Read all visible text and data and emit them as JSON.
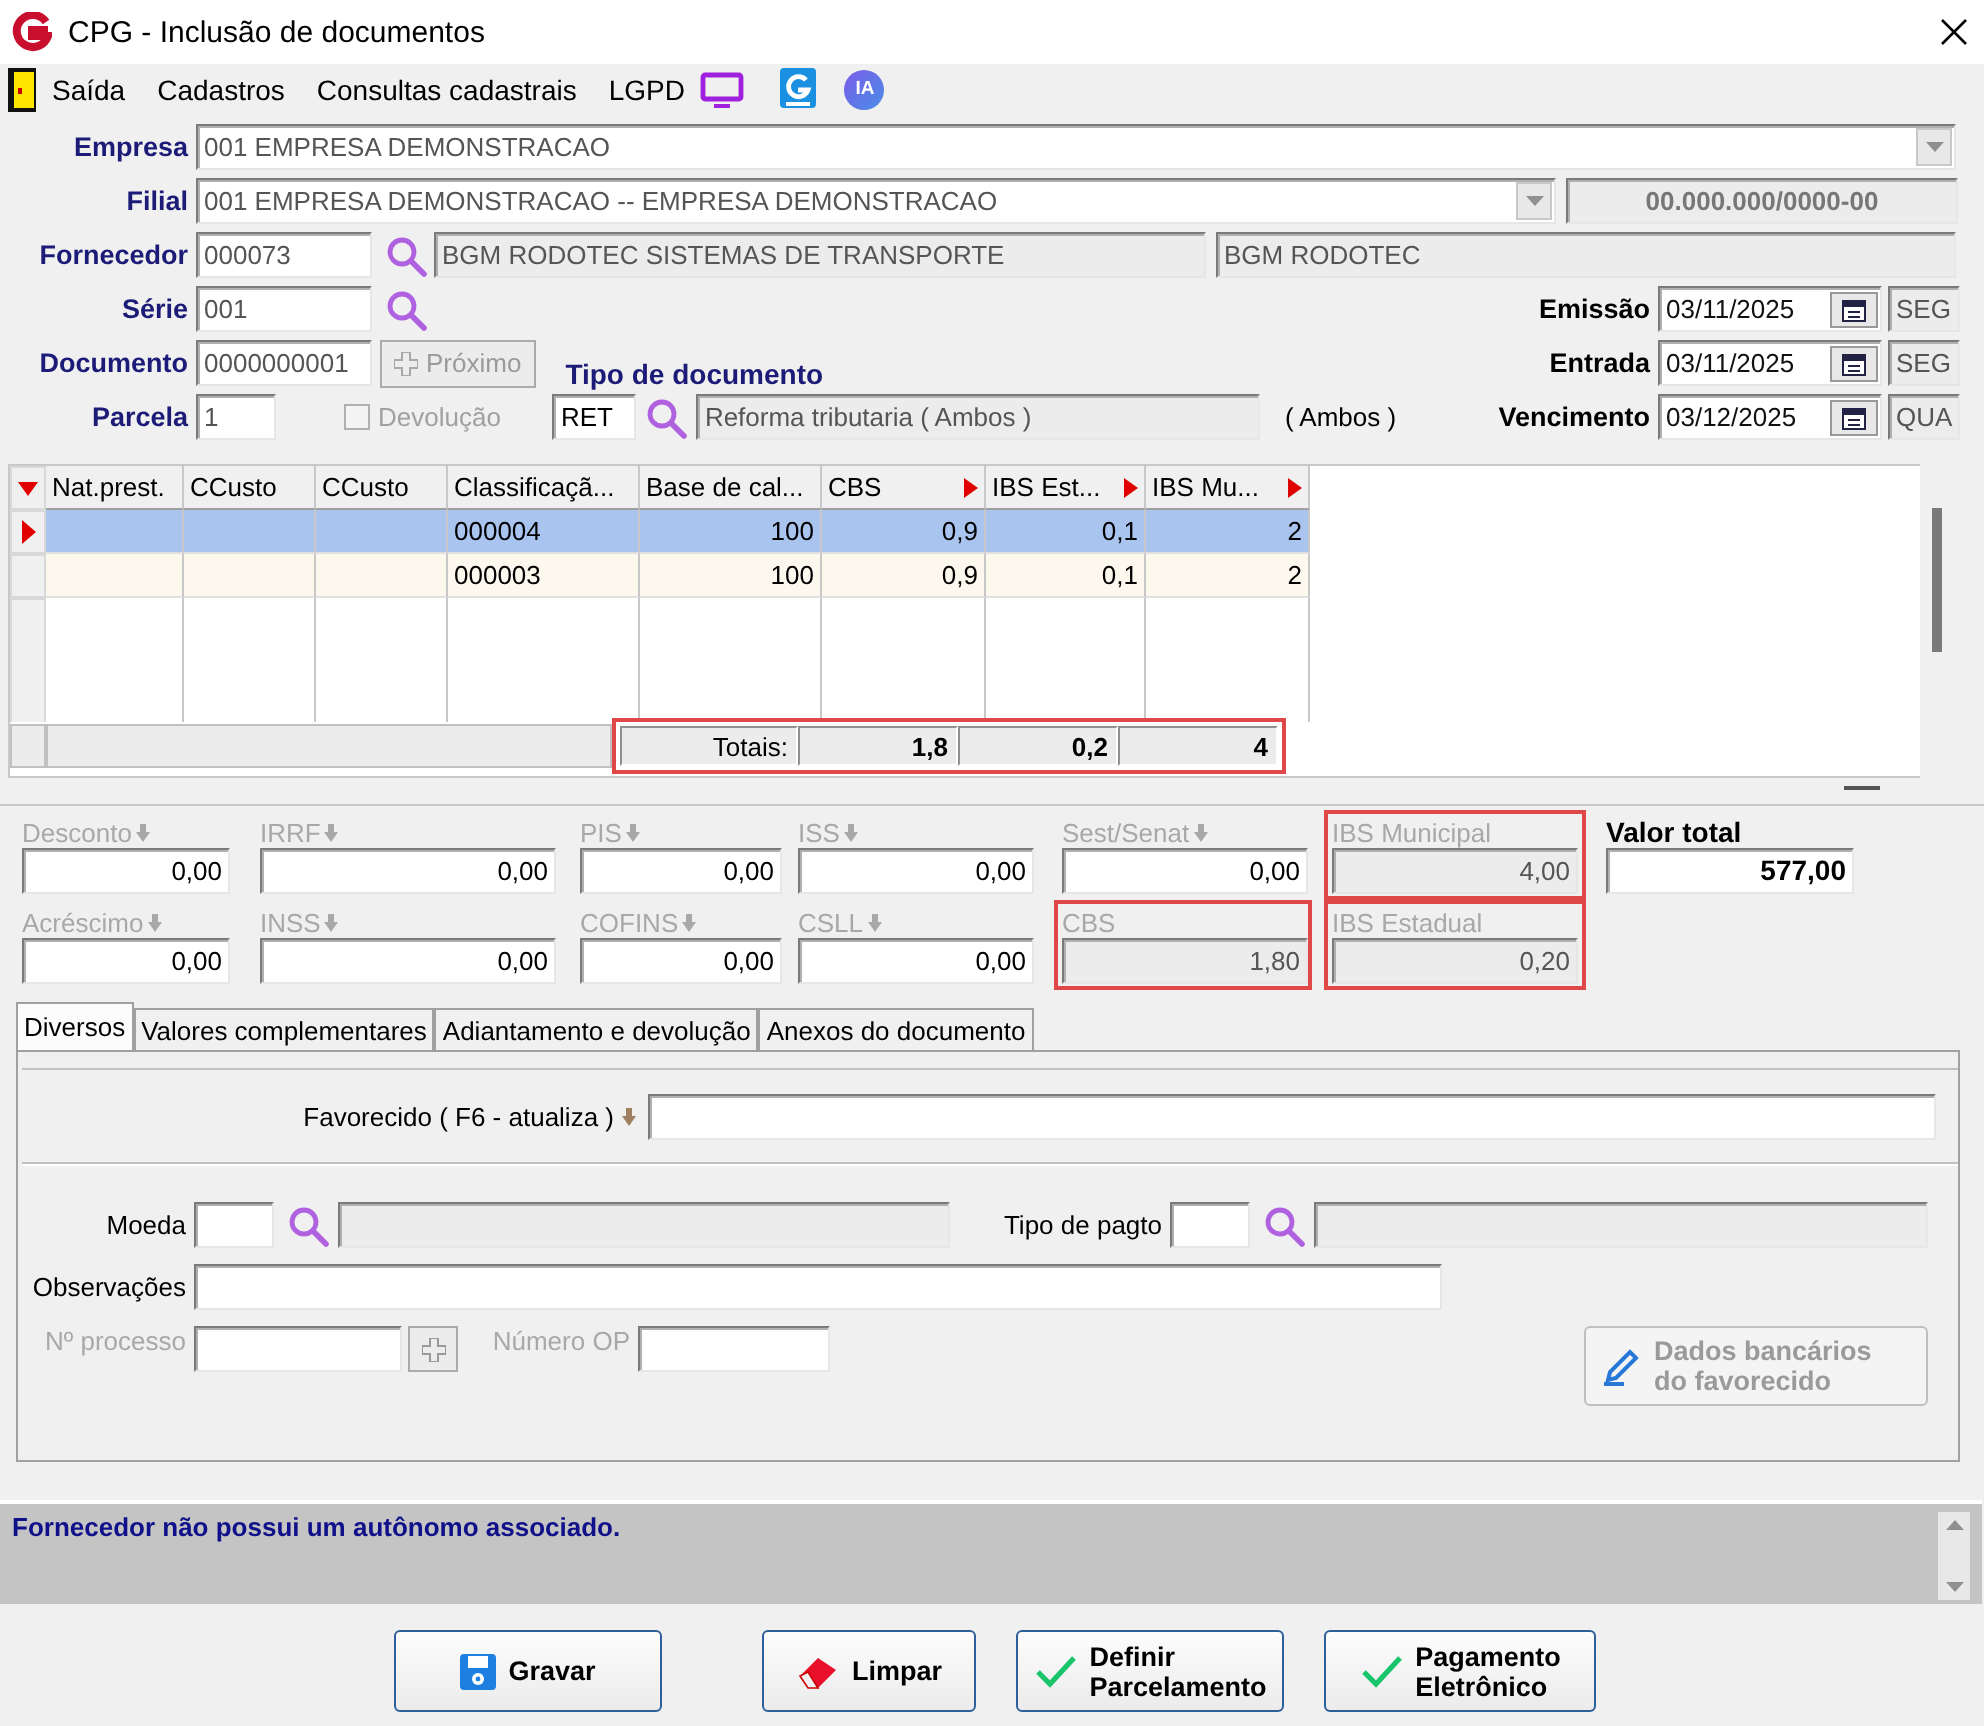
{
  "window": {
    "title": "CPG - Inclusão de documentos"
  },
  "menu": {
    "items": [
      "Saída",
      "Cadastros",
      "Consultas cadastrais",
      "LGPD"
    ],
    "assistant_badge": "IA"
  },
  "header": {
    "empresa": {
      "label": "Empresa",
      "value": "001 EMPRESA DEMONSTRACAO"
    },
    "filial": {
      "label": "Filial",
      "value": "001 EMPRESA DEMONSTRACAO -- EMPRESA DEMONSTRACAO",
      "cnpj": "00.000.000/0000-00"
    },
    "fornecedor": {
      "label": "Fornecedor",
      "code": "000073",
      "name": "BGM RODOTEC SISTEMAS DE TRANSPORTE",
      "short_name": "BGM RODOTEC"
    },
    "serie": {
      "label": "Série",
      "value": "001"
    },
    "documento": {
      "label": "Documento",
      "value": "0000000001",
      "next_button": "Próximo",
      "next_disabled": true
    },
    "parcela": {
      "label": "Parcela",
      "value": "1"
    },
    "devolucao": {
      "label": "Devolução",
      "checked": false,
      "disabled": true
    },
    "tipo_documento": {
      "label": "Tipo de documento",
      "code": "RET",
      "description": "Reforma tributaria ( Ambos )",
      "note": "( Ambos )"
    },
    "dates": [
      {
        "label": "Emissão",
        "value": "03/11/2025",
        "weekday": "SEG"
      },
      {
        "label": "Entrada",
        "value": "03/11/2025",
        "weekday": "SEG"
      },
      {
        "label": "Vencimento",
        "value": "03/12/2025",
        "weekday": "QUA"
      }
    ]
  },
  "grid": {
    "columns": [
      {
        "label": "Nat.prest.",
        "sort_marker": false
      },
      {
        "label": "CCusto",
        "sort_marker": false
      },
      {
        "label": "CCusto",
        "sort_marker": false
      },
      {
        "label": "Classificaçã...",
        "sort_marker": false
      },
      {
        "label": "Base de cal...",
        "sort_marker": false
      },
      {
        "label": "CBS",
        "sort_marker": true
      },
      {
        "label": "IBS Est...",
        "sort_marker": true
      },
      {
        "label": "IBS Mu...",
        "sort_marker": true
      }
    ],
    "rows": [
      {
        "selected": true,
        "cells": [
          null,
          null,
          null,
          "000004",
          "100",
          "0,9",
          "0,1",
          "2"
        ]
      },
      {
        "selected": false,
        "cells": [
          null,
          null,
          null,
          "000003",
          "100",
          "0,9",
          "0,1",
          "2"
        ]
      }
    ],
    "totals": {
      "label": "Totais:",
      "values": [
        "1,8",
        "0,2",
        "4"
      ],
      "highlighted": true
    }
  },
  "taxes": [
    [
      {
        "label": "Desconto",
        "value": "0,00",
        "arrow": true,
        "readonly": false,
        "highlighted": false
      },
      {
        "label": "IRRF",
        "value": "0,00",
        "arrow": true,
        "readonly": false,
        "highlighted": false
      },
      {
        "label": "PIS",
        "value": "0,00",
        "arrow": true,
        "readonly": false,
        "highlighted": false
      },
      {
        "label": "ISS",
        "value": "0,00",
        "arrow": true,
        "readonly": false,
        "highlighted": false
      },
      {
        "label": "Sest/Senat",
        "value": "0,00",
        "arrow": true,
        "readonly": false,
        "highlighted": false
      },
      {
        "label": "IBS Municipal",
        "value": "4,00",
        "arrow": false,
        "readonly": true,
        "highlighted": true
      }
    ],
    [
      {
        "label": "Acréscimo",
        "value": "0,00",
        "arrow": true,
        "readonly": false,
        "highlighted": false
      },
      {
        "label": "INSS",
        "value": "0,00",
        "arrow": true,
        "readonly": false,
        "highlighted": false
      },
      {
        "label": "COFINS",
        "value": "0,00",
        "arrow": true,
        "readonly": false,
        "highlighted": false
      },
      {
        "label": "CSLL",
        "value": "0,00",
        "arrow": true,
        "readonly": false,
        "highlighted": false
      },
      {
        "label": "CBS",
        "value": "1,80",
        "arrow": false,
        "readonly": true,
        "highlighted": true
      },
      {
        "label": "IBS Estadual",
        "value": "0,20",
        "arrow": false,
        "readonly": true,
        "highlighted": true
      }
    ]
  ],
  "valor_total": {
    "label": "Valor total",
    "value": "577,00"
  },
  "tabs": [
    {
      "label": "Diversos",
      "selected": true
    },
    {
      "label": "Valores complementares",
      "selected": false
    },
    {
      "label": "Adiantamento e devolução",
      "selected": false
    },
    {
      "label": "Anexos do documento",
      "selected": false
    }
  ],
  "diversos": {
    "favorecido": {
      "label": "Favorecido ( F6 - atualiza )"
    },
    "moeda": {
      "label": "Moeda"
    },
    "tipo_pagto": {
      "label": "Tipo de pagto"
    },
    "observacoes": {
      "label": "Observações"
    },
    "processo": {
      "label": "Nº processo",
      "disabled": true
    },
    "numero_op": {
      "label": "Número OP",
      "disabled": true
    },
    "bank_button": {
      "lines": [
        "Dados bancários",
        "do favorecido"
      ],
      "disabled": true
    }
  },
  "status_message": "Fornecedor não possui um autônomo associado.",
  "buttons": [
    {
      "kind": "save",
      "lines": [
        "Gravar"
      ]
    },
    {
      "kind": "clear",
      "lines": [
        "Limpar"
      ]
    },
    {
      "kind": "confirm",
      "lines": [
        "Definir",
        "Parcelamento"
      ]
    },
    {
      "kind": "confirm",
      "lines": [
        "Pagamento",
        "Eletrônico"
      ]
    }
  ]
}
